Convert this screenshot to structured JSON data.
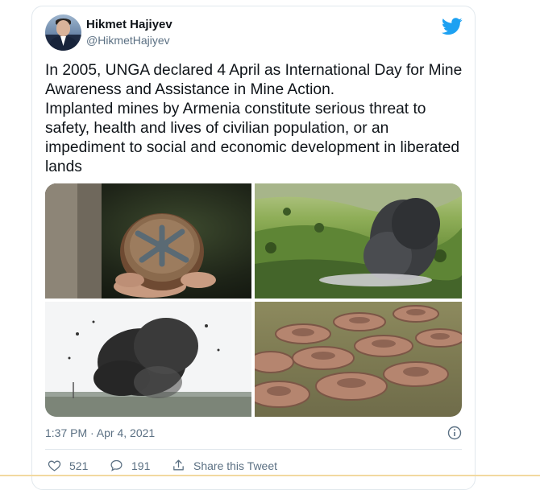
{
  "author": {
    "name": "Hikmet Hajiyev",
    "handle": "@HikmetHajiyev"
  },
  "tweet": {
    "text": "In 2005, UNGA declared 4 April as  International Day for Mine Awareness and Assistance in Mine Action.\nImplanted mines by Armenia constitute serious threat to safety, health and lives of civilian population, or an impediment to social and economic development in liberated lands"
  },
  "meta": {
    "time": "1:37 PM · Apr 4, 2021"
  },
  "actions": {
    "likes": "521",
    "comments": "191",
    "share_label": "Share this Tweet"
  },
  "icons": {
    "brand": "twitter-bird-icon",
    "info": "info-icon",
    "like": "heart-icon",
    "comment": "comment-icon",
    "share": "share-icon"
  },
  "colors": {
    "brand_blue": "#1da1f2",
    "text": "#0f1419",
    "muted": "#5b7083",
    "border": "#e1e8ed"
  }
}
